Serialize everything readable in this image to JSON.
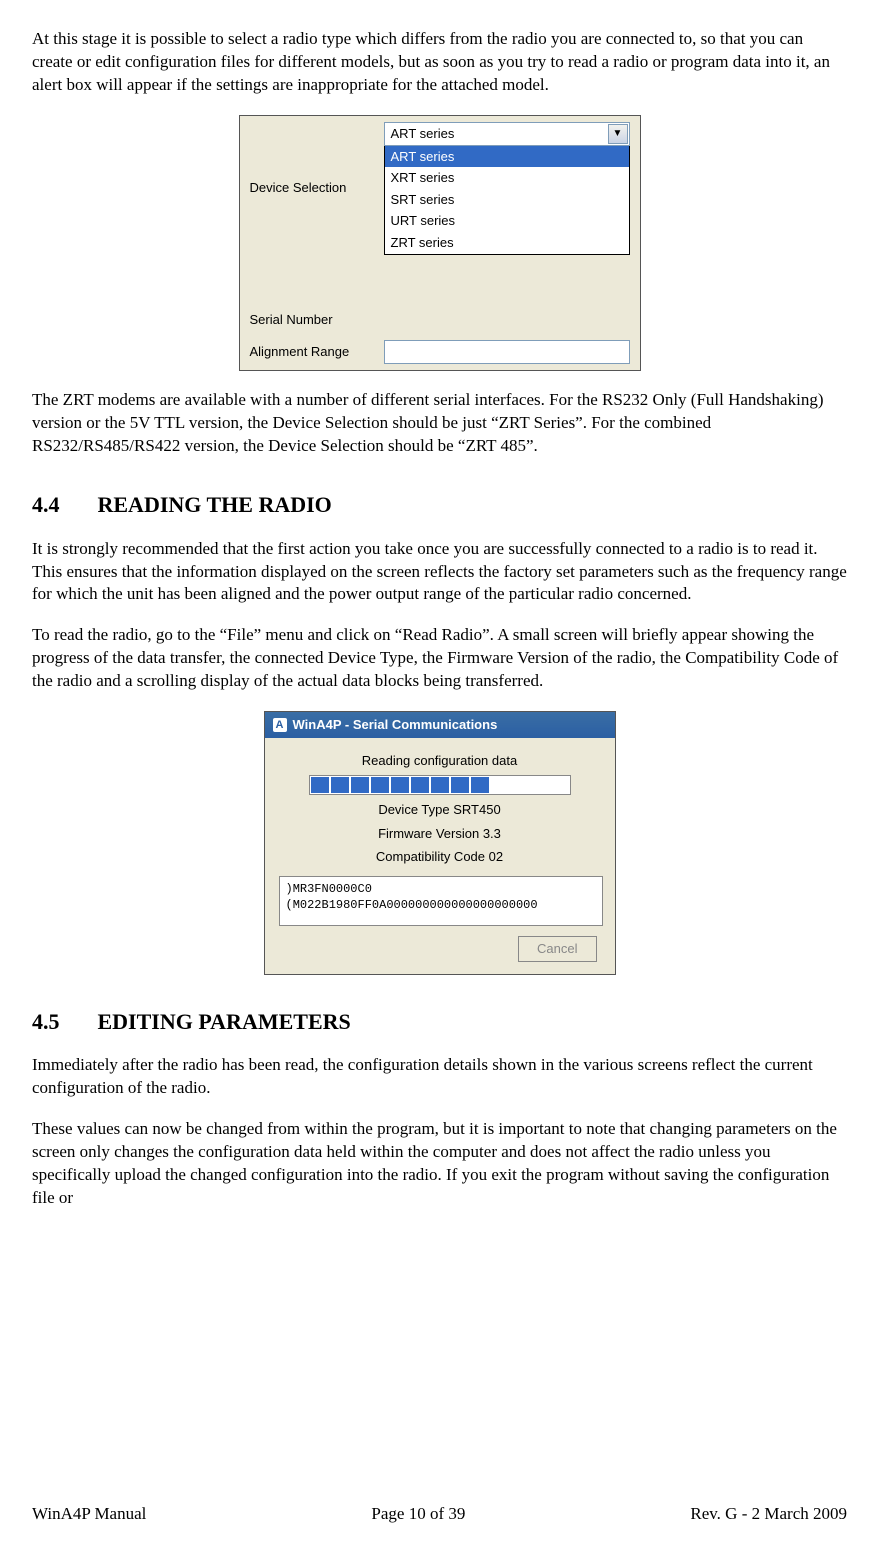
{
  "para1": "At this stage it is possible to select a radio type which differs from the radio you are connected to, so that you can create or edit configuration files for different models, but as soon as you try to read a radio or program data into it, an alert box will appear if the settings are inappropriate for the attached model.",
  "fig1": {
    "device_selection_label": "Device Selection",
    "selected": "ART series",
    "options": [
      "ART series",
      "XRT series",
      "SRT series",
      "URT series",
      "ZRT series"
    ],
    "serial_number_label": "Serial Number",
    "alignment_range_label": "Alignment Range",
    "alignment_value": ""
  },
  "para2": "The ZRT modems are available with a number of different serial interfaces.  For the RS232 Only (Full Handshaking) version or the 5V TTL version, the Device Selection should be just “ZRT Series”.  For the combined RS232/RS485/RS422 version, the Device Selection should be “ZRT 485”.",
  "sec44_num": "4.4",
  "sec44_title": "READING THE RADIO",
  "para3": "It is strongly recommended that the first action you take once you are successfully connected to a radio is to read it.  This ensures that the information displayed on the screen reflects the factory set parameters such as the frequency range for which the unit has been aligned and the power output range of the particular radio concerned.",
  "para4": "To read the radio, go to the “File” menu and click on “Read Radio”.  A small screen will briefly appear showing the progress of the data transfer, the connected Device Type, the Firmware Version of the radio, the Compatibility Code of the radio and a scrolling display of the actual data blocks being transferred.",
  "fig2": {
    "title": "WinA4P - Serial Communications",
    "status": "Reading configuration data",
    "device_type": "Device Type SRT450",
    "firmware": "Firmware Version 3.3",
    "compat": "Compatibility Code 02",
    "data1": ")MR3FN0000C0",
    "data2": "(M022B1980FF0A000000000000000000000",
    "cancel": "Cancel",
    "progress_blocks": 9
  },
  "sec45_num": "4.5",
  "sec45_title": "EDITING PARAMETERS",
  "para5": "Immediately after the radio has been read, the configuration details shown in the various screens reflect the current configuration of the radio.",
  "para6": "These values can now be changed from within the program, but it is important to note that changing parameters on the screen only changes the configuration data held within the computer and does not affect the radio unless you specifically upload the changed configuration into the radio.  If you exit the program without saving the configuration file or",
  "footer": {
    "left": "WinA4P Manual",
    "center": "Page 10 of 39",
    "right": "Rev. G -  2 March 2009"
  }
}
